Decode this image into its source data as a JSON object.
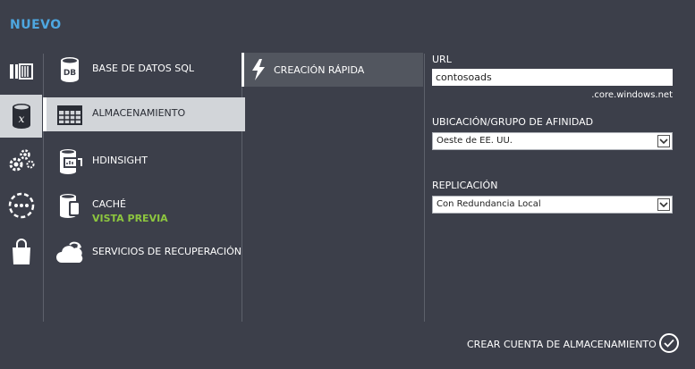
{
  "header": {
    "title": "NUEVO"
  },
  "categories": [
    {
      "name": "compute-icon"
    },
    {
      "name": "data-services-icon",
      "selected": true
    },
    {
      "name": "app-services-icon"
    },
    {
      "name": "network-services-icon"
    },
    {
      "name": "store-icon"
    }
  ],
  "services": [
    {
      "label": "BASE DE DATOS SQL",
      "icon": "sql-database-icon"
    },
    {
      "label": "ALMACENAMIENTO",
      "icon": "storage-table-icon",
      "selected": true
    },
    {
      "label": "HDINSIGHT",
      "icon": "hdinsight-icon"
    },
    {
      "label": "CACHÉ",
      "sublabel": "VISTA PREVIA",
      "icon": "cache-icon"
    },
    {
      "label": "SERVICIOS DE RECUPERACIÓN",
      "icon": "recovery-cloud-icon"
    }
  ],
  "options": [
    {
      "label": "CREACIÓN RÁPIDA",
      "icon": "lightning-icon"
    }
  ],
  "form": {
    "url_label": "URL",
    "url_value": "contosoads",
    "url_suffix": ".core.windows.net",
    "location_label": "UBICACIÓN/GRUPO DE AFINIDAD",
    "location_value": "Oeste de EE. UU.",
    "replication_label": "REPLICACIÓN",
    "replication_value": "Con Redundancia Local"
  },
  "footer": {
    "create_label": "CREAR CUENTA DE ALMACENAMIENTO"
  },
  "colors": {
    "background": "#3c3f4a",
    "title": "#4ea7e0",
    "preview": "#8dc63f",
    "selected": "#d2d5d9"
  }
}
